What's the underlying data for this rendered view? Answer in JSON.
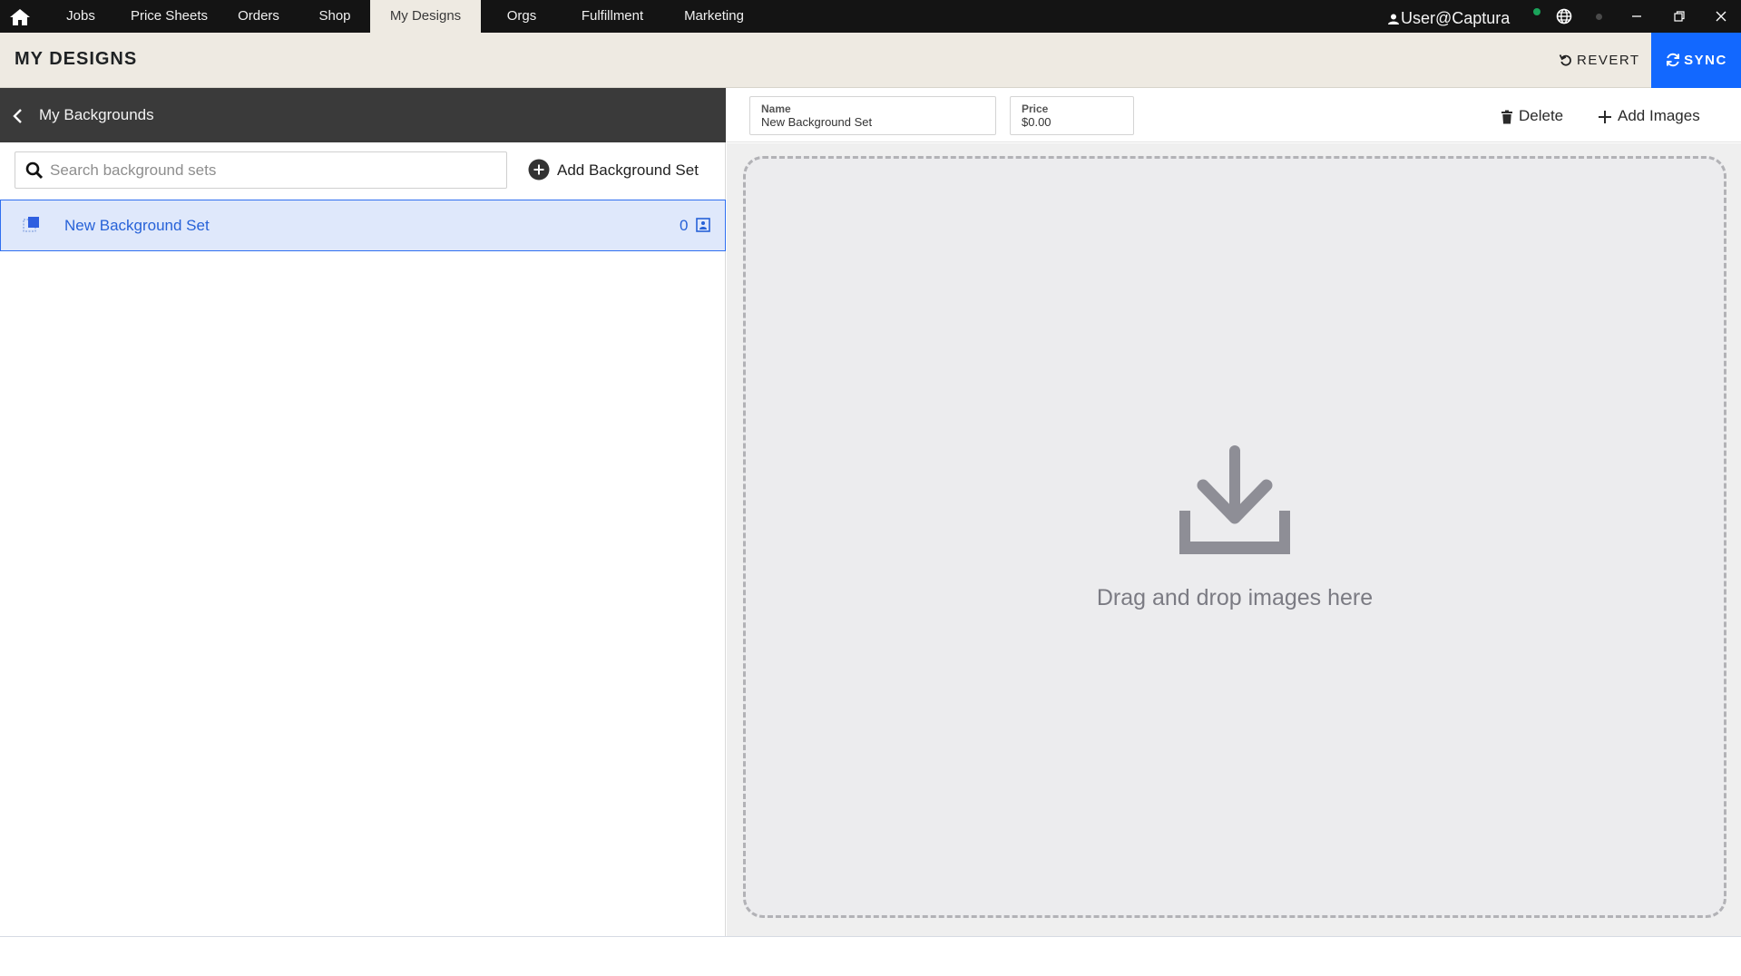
{
  "topbar": {
    "nav": [
      {
        "label": "Jobs"
      },
      {
        "label": "Price Sheets"
      },
      {
        "label": "Orders"
      },
      {
        "label": "Shop"
      },
      {
        "label": "My Designs",
        "active": true
      },
      {
        "label": "Orgs"
      },
      {
        "label": "Fulfillment"
      },
      {
        "label": "Marketing"
      }
    ],
    "user": "User@Captura",
    "icons": [
      "home-icon",
      "user-icon",
      "globe-icon",
      "minimize-icon",
      "restore-icon",
      "close-icon"
    ]
  },
  "header": {
    "title": "MY DESIGNS",
    "revert_label": "REVERT",
    "sync_label": "SYNC",
    "accent": "#1268ff"
  },
  "left": {
    "title": "My Backgrounds",
    "search_placeholder": "Search background sets",
    "add_label": "Add Background Set",
    "sets": [
      {
        "name": "New Background Set",
        "count": "0",
        "selected": true
      }
    ]
  },
  "right": {
    "name_label": "Name",
    "name_value": "New Background Set",
    "price_label": "Price",
    "price_value": "$0.00",
    "delete_label": "Delete",
    "add_images_label": "Add Images",
    "drop_text": "Drag and drop images here"
  }
}
